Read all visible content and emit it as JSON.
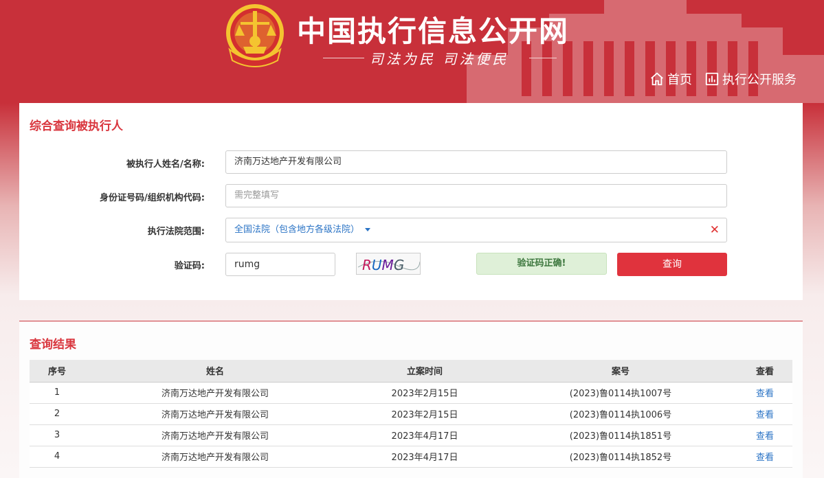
{
  "header": {
    "site_title": "中国执行信息公开网",
    "slogan": "司法为民   司法便民",
    "nav": [
      {
        "label": "首页",
        "icon": "home-icon"
      },
      {
        "label": "执行公开服务",
        "icon": "chart-icon"
      }
    ]
  },
  "search": {
    "title": "综合查询被执行人",
    "name_label": "被执行人姓名/名称:",
    "name_value": "济南万达地产开发有限公司",
    "id_label": "身份证号码/组织机构代码:",
    "id_placeholder": "需完整填写",
    "court_label": "执行法院范围:",
    "court_value": "全国法院（包含地方各级法院）",
    "captcha_label": "验证码:",
    "captcha_value": "rumg",
    "captcha_image_text": "RUMG",
    "captcha_status": "验证码正确!",
    "query_button": "查询"
  },
  "results": {
    "title": "查询结果",
    "columns": [
      "序号",
      "姓名",
      "立案时间",
      "案号",
      "查看"
    ],
    "rows": [
      {
        "index": "1",
        "name": "济南万达地产开发有限公司",
        "date": "2023年2月15日",
        "case": "(2023)鲁0114执1007号",
        "view": "查看"
      },
      {
        "index": "2",
        "name": "济南万达地产开发有限公司",
        "date": "2023年2月15日",
        "case": "(2023)鲁0114执1006号",
        "view": "查看"
      },
      {
        "index": "3",
        "name": "济南万达地产开发有限公司",
        "date": "2023年4月17日",
        "case": "(2023)鲁0114执1851号",
        "view": "查看"
      },
      {
        "index": "4",
        "name": "济南万达地产开发有限公司",
        "date": "2023年4月17日",
        "case": "(2023)鲁0114执1852号",
        "view": "查看"
      }
    ]
  },
  "colors": {
    "brand_red": "#c8303a",
    "button_red": "#e0333d",
    "link_blue": "#2a73c5",
    "success_green": "#3c763d"
  }
}
